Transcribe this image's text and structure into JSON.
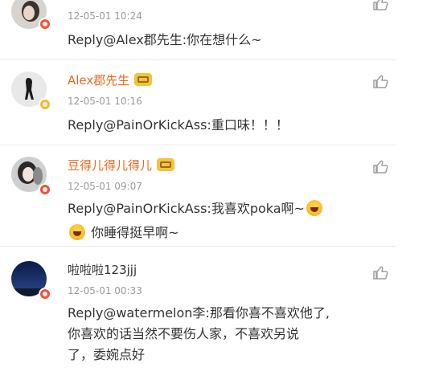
{
  "colors": {
    "vip_name": "#e86a1c",
    "plain_name": "#333333",
    "timestamp": "#9a9a9a",
    "text": "#333333",
    "divider": "#e9e9e9",
    "badge_red": "#e8563f",
    "badge_gold": "#f0b93a"
  },
  "comments": [
    {
      "time": "12-05-01 10:24",
      "reply": "Reply@Alex郡先生:你在想什么~",
      "avatar_badge": "red"
    },
    {
      "user": "Alex郡先生",
      "time": "12-05-01 10:16",
      "reply": "Reply@PainOrKickAss:重口味！！！",
      "avatar_badge": "gold",
      "vip": true
    },
    {
      "user": "豆得儿得儿得儿",
      "time": "12-05-01 09:07",
      "reply_line1": "Reply@PainOrKickAss:我喜欢poka啊~",
      "reply_line2": "你睡得挺早啊~",
      "avatar_badge": "red",
      "vip": true
    },
    {
      "user": "啦啦啦123jjj",
      "time": "12-05-01 00:33",
      "reply_line1": "Reply@watermelon李:那看你喜不喜欢他了,",
      "reply_line2": "你喜欢的话当然不要伤人家，不喜欢另说",
      "reply_line3": "了，委婉点好",
      "avatar_badge": "red",
      "vip": false
    }
  ],
  "icons": {
    "like": "thumbs-up-icon",
    "crown": "vip-crown-icon",
    "emoji": "laughing-emoji-icon"
  }
}
